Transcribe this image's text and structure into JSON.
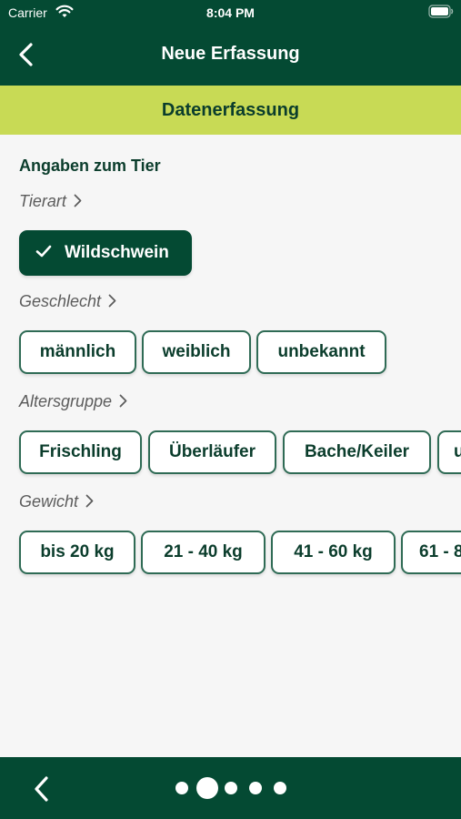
{
  "status_bar": {
    "carrier": "Carrier",
    "time": "8:04 PM"
  },
  "header": {
    "title": "Neue Erfassung"
  },
  "section": {
    "title": "Datenerfassung"
  },
  "form": {
    "group_title": "Angaben zum Tier",
    "tierart": {
      "label": "Tierart",
      "options": [
        "Wildschwein"
      ],
      "selected": "Wildschwein"
    },
    "geschlecht": {
      "label": "Geschlecht",
      "options": [
        "männlich",
        "weiblich",
        "unbekannt"
      ]
    },
    "altersgruppe": {
      "label": "Altersgruppe",
      "options": [
        "Frischling",
        "Überläufer",
        "Bache/Keiler",
        "u"
      ]
    },
    "gewicht": {
      "label": "Gewicht",
      "options": [
        "bis 20 kg",
        "21 - 40 kg",
        "41 - 60 kg",
        "61 - 8"
      ]
    }
  },
  "pager": {
    "pages": 5,
    "current_page": 2
  },
  "colors": {
    "primary": "#044a33",
    "accent": "#c8da55",
    "background": "#f6f6f6"
  }
}
